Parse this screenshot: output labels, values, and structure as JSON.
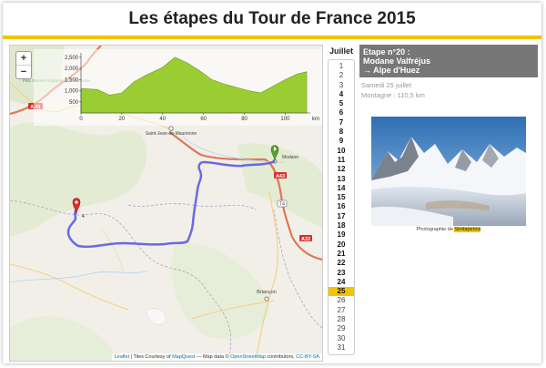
{
  "page": {
    "title": "Les étapes du Tour de France 2015"
  },
  "map": {
    "zoom_in": "+",
    "zoom_out": "−",
    "labels": {
      "saint_jean": "Saint-Jean-de-Maurienne",
      "modane": "Modane",
      "briancon": "Briançon",
      "a41": "A 41",
      "a43": "A43",
      "a32": "A32",
      "t4": "T4",
      "chamrousse": "Parc Naturel Régional de Chartreuse",
      "end_marker": "4"
    },
    "route_color": "#5b5ae6",
    "start_marker_color": "#5aa02c",
    "end_marker_color": "#d9302c",
    "attribution": {
      "leaflet": "Leaflet",
      "tiles_prefix": " | Tiles Courtesy of ",
      "mapquest": "MapQuest",
      "data_prefix": " — Map data © ",
      "osm": "OpenStreetMap",
      "contrib": " contributors, ",
      "license": "CC-BY-SA"
    },
    "elevation": {
      "y_ticks": [
        "2,500",
        "2,000",
        "1,500",
        "1,000",
        "500"
      ],
      "y_values": [
        2500,
        2000,
        1500,
        1000,
        500
      ],
      "x_ticks": [
        "0",
        "20",
        "40",
        "60",
        "80",
        "100"
      ],
      "x_values": [
        0,
        20,
        40,
        60,
        80,
        100
      ],
      "x_unit": "km",
      "fill_color": "#9acd32",
      "profile": [
        [
          0,
          1100
        ],
        [
          8,
          1050
        ],
        [
          14,
          800
        ],
        [
          20,
          900
        ],
        [
          26,
          1400
        ],
        [
          32,
          1700
        ],
        [
          40,
          2050
        ],
        [
          46,
          2500
        ],
        [
          52,
          2250
        ],
        [
          58,
          1900
        ],
        [
          64,
          1500
        ],
        [
          70,
          1300
        ],
        [
          76,
          1150
        ],
        [
          82,
          1000
        ],
        [
          88,
          900
        ],
        [
          94,
          1200
        ],
        [
          100,
          1500
        ],
        [
          106,
          1750
        ],
        [
          110.5,
          1850
        ]
      ]
    }
  },
  "calendar": {
    "month": "Juillet",
    "days": [
      "1",
      "2",
      "3",
      "4",
      "5",
      "6",
      "7",
      "8",
      "9",
      "10",
      "11",
      "12",
      "13",
      "14",
      "15",
      "16",
      "17",
      "18",
      "19",
      "20",
      "21",
      "22",
      "23",
      "24",
      "25",
      "26",
      "27",
      "28",
      "29",
      "30",
      "31"
    ],
    "stage_days": [
      "4",
      "5",
      "6",
      "7",
      "8",
      "9",
      "10",
      "11",
      "12",
      "13",
      "14",
      "15",
      "16",
      "17",
      "18",
      "19",
      "20",
      "21",
      "22",
      "23",
      "24",
      "25"
    ],
    "selected": "25"
  },
  "stage": {
    "title_line1": "Etape n°20 :",
    "title_line2": "Modane Valfréjus",
    "title_line3": "→ Alpe d'Huez",
    "date": "Samedi 25 juillet",
    "type": "Montagne : 110,5 km",
    "photo_credit_prefix": "Photographie de ",
    "photo_credit_author": "Sindapence"
  }
}
